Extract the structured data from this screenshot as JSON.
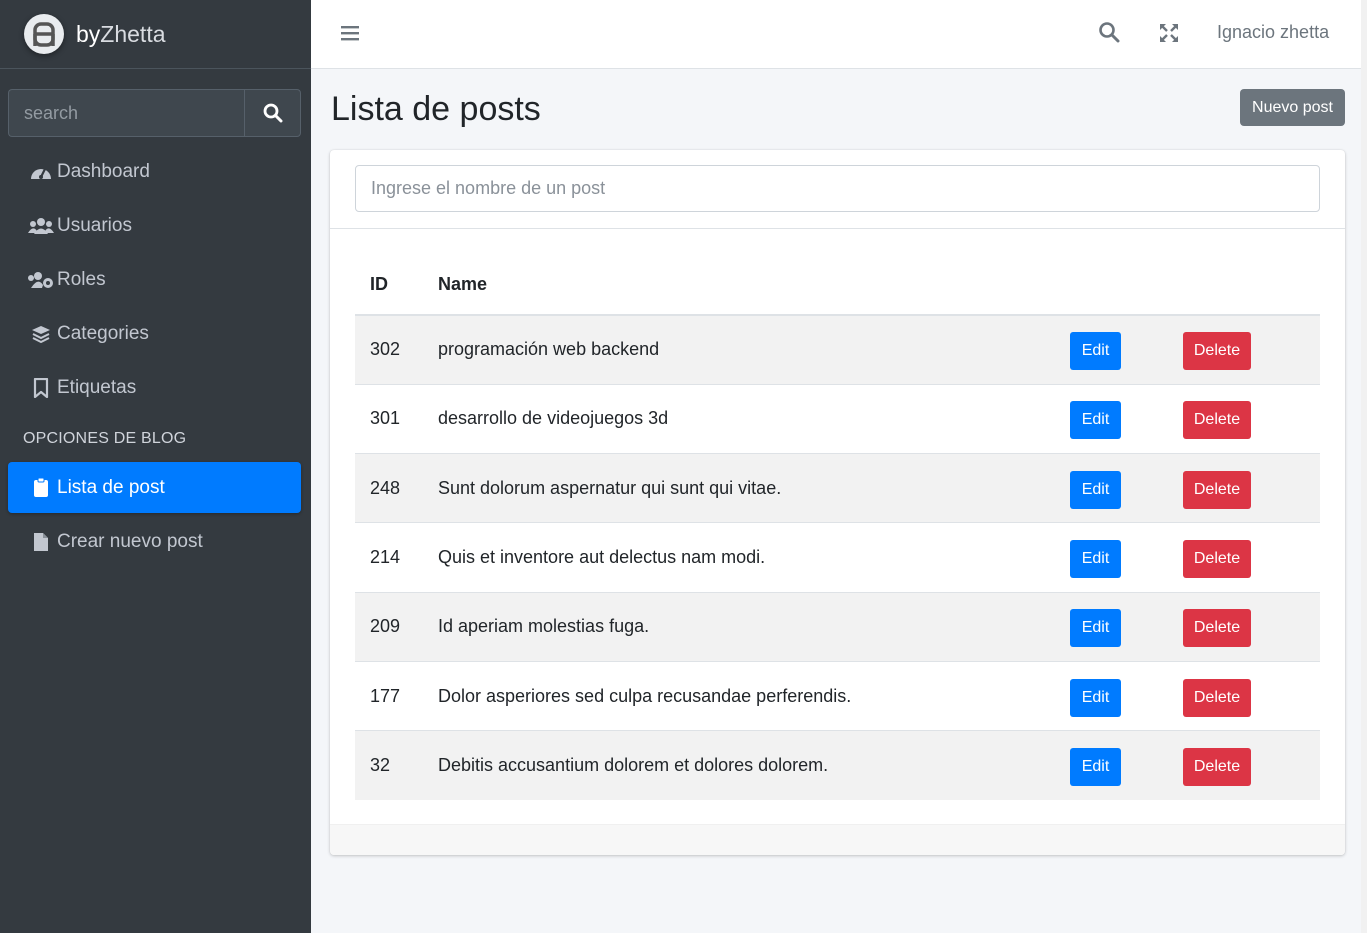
{
  "brand": {
    "prefix": "by",
    "name": "Zhetta"
  },
  "sidebar": {
    "search_placeholder": "search",
    "items": [
      {
        "label": "Dashboard",
        "icon": "tachometer-icon"
      },
      {
        "label": "Usuarios",
        "icon": "users-icon"
      },
      {
        "label": "Roles",
        "icon": "users-cog-icon"
      },
      {
        "label": "Categories",
        "icon": "layers-icon"
      },
      {
        "label": "Etiquetas",
        "icon": "bookmark-icon"
      }
    ],
    "section_header": "OPCIONES DE BLOG",
    "blog_items": [
      {
        "label": "Lista de post",
        "icon": "clipboard-icon",
        "active": true
      },
      {
        "label": "Crear nuevo post",
        "icon": "file-icon"
      }
    ]
  },
  "topbar": {
    "user": "Ignacio zhetta"
  },
  "page": {
    "title": "Lista de posts",
    "new_post_label": "Nuevo post",
    "filter_placeholder": "Ingrese el nombre de un post"
  },
  "table": {
    "headers": {
      "id": "ID",
      "name": "Name"
    },
    "edit_label": "Edit",
    "delete_label": "Delete",
    "rows": [
      {
        "id": "302",
        "name": "programación web backend"
      },
      {
        "id": "301",
        "name": "desarrollo de videojuegos 3d"
      },
      {
        "id": "248",
        "name": "Sunt dolorum aspernatur qui sunt qui vitae."
      },
      {
        "id": "214",
        "name": "Quis et inventore aut delectus nam modi."
      },
      {
        "id": "209",
        "name": "Id aperiam molestias fuga."
      },
      {
        "id": "177",
        "name": "Dolor asperiores sed culpa recusandae perferendis."
      },
      {
        "id": "32",
        "name": "Debitis accusantium dolorem et dolores dolorem."
      }
    ]
  },
  "colors": {
    "primary": "#007bff",
    "danger": "#dc3545",
    "secondary": "#6c757d",
    "sidebar_bg": "#343a40"
  }
}
